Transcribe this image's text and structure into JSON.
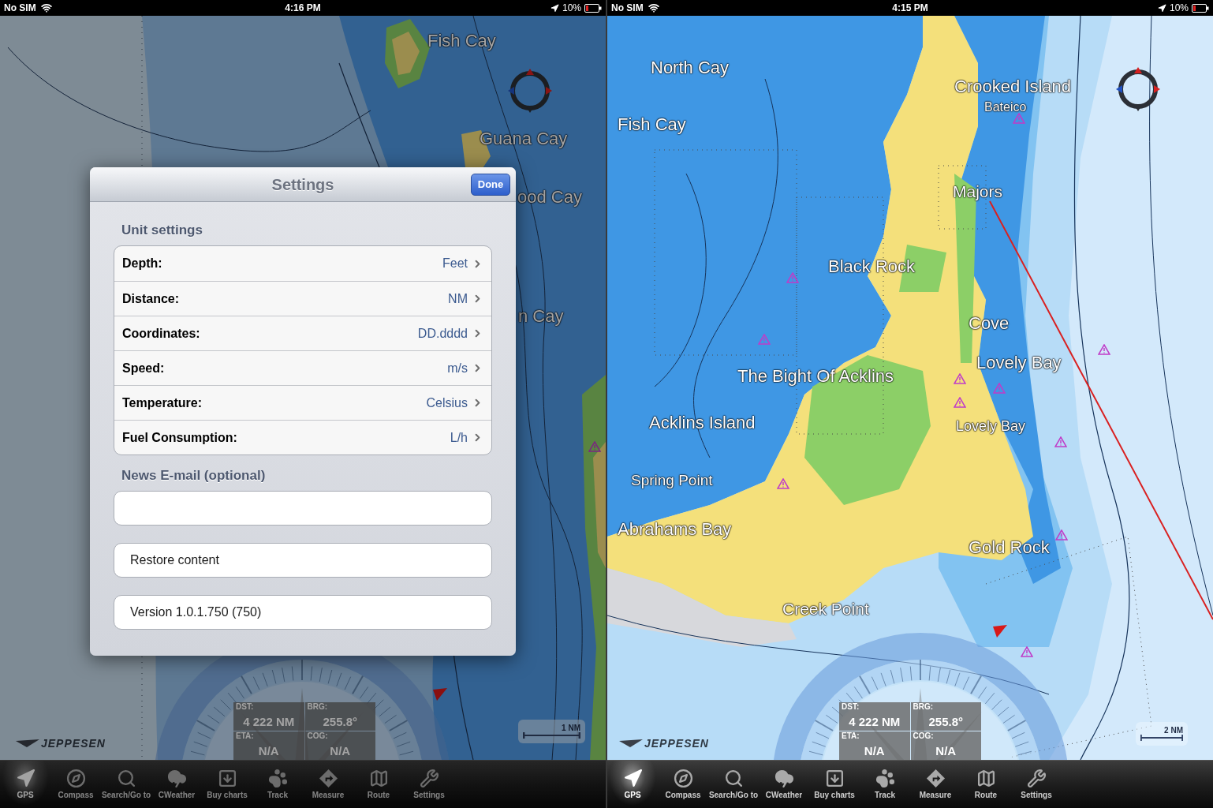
{
  "panes": [
    {
      "status_bar": {
        "carrier": "No SIM",
        "time": "4:16 PM",
        "battery": "10%"
      },
      "dimmed": true,
      "map": {
        "labels": [
          "Fish Cay",
          "Guana Cay",
          "ood Cay",
          "n Cay"
        ],
        "scale": "1 NM",
        "logo": "JEPPESEN"
      },
      "nav_panel": [
        {
          "label": "DST:",
          "value": "4 222 NM"
        },
        {
          "label": "BRG:",
          "value": "255.8°"
        },
        {
          "label": "ETA:",
          "value": "N/A"
        },
        {
          "label": "COG:",
          "value": "N/A"
        }
      ],
      "toolbar": [
        {
          "label": "GPS",
          "selected": true
        },
        {
          "label": "Compass",
          "selected": false
        },
        {
          "label": "Search/Go to",
          "selected": false
        },
        {
          "label": "CWeather",
          "selected": false
        },
        {
          "label": "Buy charts",
          "selected": false
        },
        {
          "label": "Track",
          "selected": false
        },
        {
          "label": "Measure",
          "selected": false
        },
        {
          "label": "Route",
          "selected": false
        },
        {
          "label": "Settings",
          "selected": false
        }
      ],
      "settings_dialog": {
        "title": "Settings",
        "done_button": "Done",
        "unit_settings": {
          "heading": "Unit settings",
          "rows": [
            {
              "label": "Depth:",
              "value": "Feet"
            },
            {
              "label": "Distance:",
              "value": "NM"
            },
            {
              "label": "Coordinates:",
              "value": "DD.dddd"
            },
            {
              "label": "Speed:",
              "value": "m/s"
            },
            {
              "label": "Temperature:",
              "value": "Celsius"
            },
            {
              "label": "Fuel Consumption:",
              "value": "L/h"
            }
          ]
        },
        "news_email": {
          "heading": "News E-mail (optional)"
        },
        "restore_button": "Restore content",
        "version": "Version 1.0.1.750 (750)"
      }
    },
    {
      "status_bar": {
        "carrier": "No SIM",
        "time": "4:15 PM",
        "battery": "10%"
      },
      "dimmed": false,
      "map": {
        "labels": [
          "North Cay",
          "Crooked Island",
          "Bateico",
          "Fish Cay",
          "Majors",
          "Black Rock",
          "Cove",
          "Lovely Bay",
          "The Bight Of Acklins",
          "Lovely Bay",
          "Acklins Island",
          "Spring Point",
          "Abrahams Bay",
          "Gold Rock",
          "Creek Point"
        ],
        "scale": "2 NM",
        "logo": "JEPPESEN"
      },
      "nav_panel": [
        {
          "label": "DST:",
          "value": "4 222 NM"
        },
        {
          "label": "BRG:",
          "value": "255.8°"
        },
        {
          "label": "ETA:",
          "value": "N/A"
        },
        {
          "label": "COG:",
          "value": "N/A"
        }
      ],
      "toolbar": [
        {
          "label": "GPS",
          "selected": true
        },
        {
          "label": "Compass",
          "selected": false
        },
        {
          "label": "Search/Go to",
          "selected": false
        },
        {
          "label": "CWeather",
          "selected": false
        },
        {
          "label": "Buy charts",
          "selected": false
        },
        {
          "label": "Track",
          "selected": false
        },
        {
          "label": "Measure",
          "selected": false
        },
        {
          "label": "Route",
          "selected": false
        },
        {
          "label": "Settings",
          "selected": false
        }
      ]
    }
  ]
}
